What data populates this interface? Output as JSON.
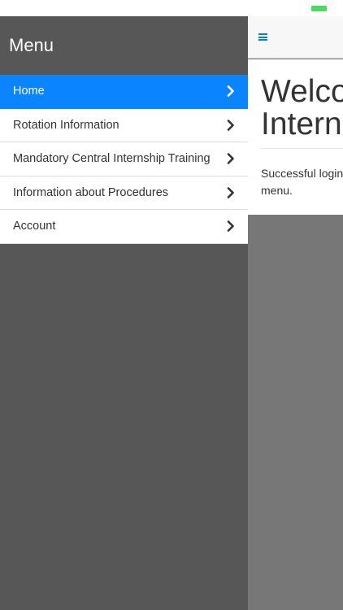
{
  "colors": {
    "accent": "#0a84ff",
    "menu_bg": "#575757",
    "battery": "#4cd964",
    "hamburger": "#0a7bd6"
  },
  "icons": {
    "battery": "battery-icon",
    "menu_toggle": "hamburger-icon",
    "item_arrow": "chevron-right-icon"
  },
  "menu": {
    "title": "Menu",
    "items": [
      {
        "label": "Home",
        "active": true
      },
      {
        "label": "Rotation Information",
        "active": false
      },
      {
        "label": "Mandatory Central Internship Training",
        "active": false
      },
      {
        "label": "Information about Procedures",
        "active": false
      },
      {
        "label": "Account",
        "active": false
      }
    ]
  },
  "main": {
    "title_line1": "Welco",
    "title_line2": "Intern",
    "message_line1": "Successful login",
    "message_line2": "menu."
  }
}
